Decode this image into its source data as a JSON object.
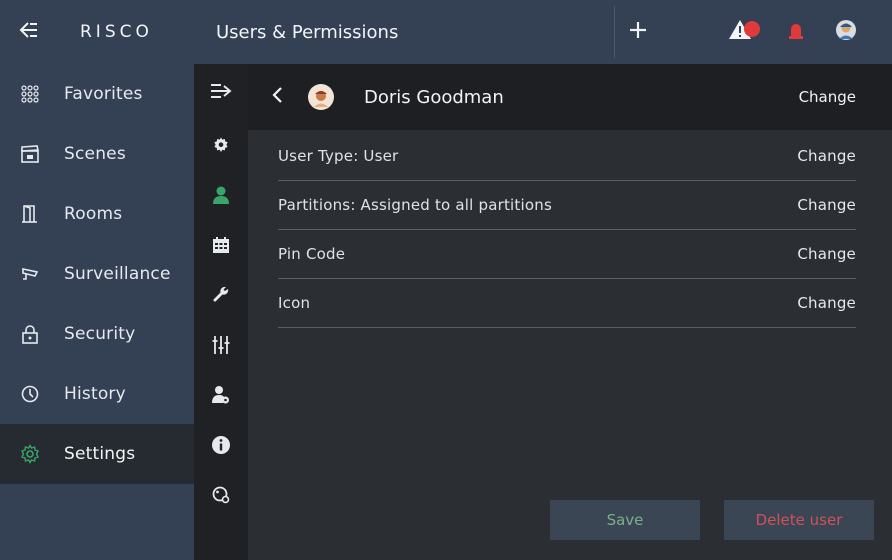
{
  "app": {
    "logo": "RISCO"
  },
  "header": {
    "title": "Users & Permissions"
  },
  "sidebar": {
    "items": [
      {
        "label": "Favorites",
        "icon": "grid-dots-icon"
      },
      {
        "label": "Scenes",
        "icon": "clapperboard-icon"
      },
      {
        "label": "Rooms",
        "icon": "door-icon"
      },
      {
        "label": "Surveillance",
        "icon": "camera-icon"
      },
      {
        "label": "Security",
        "icon": "lock-icon"
      },
      {
        "label": "History",
        "icon": "clock-icon"
      },
      {
        "label": "Settings",
        "icon": "gear-icon",
        "active": true
      }
    ]
  },
  "subrail": {
    "items": [
      "gear-icon",
      "user-icon",
      "calendar-icon",
      "wrench-icon",
      "sliders-icon",
      "user-settings-icon",
      "info-icon",
      "network-icon"
    ],
    "active": "user-icon"
  },
  "user": {
    "name": "Doris Goodman",
    "change_label": "Change"
  },
  "fields": [
    {
      "label": "User Type: User",
      "action": "Change"
    },
    {
      "label": "Partitions: Assigned to all partitions",
      "action": "Change"
    },
    {
      "label": "Pin Code",
      "action": "Change"
    },
    {
      "label": "Icon",
      "action": "Change"
    }
  ],
  "actions": {
    "save": "Save",
    "delete": "Delete user"
  },
  "colors": {
    "accent": "#3aa56b",
    "alert": "#e03a3a",
    "sidebar": "#344154",
    "save_text": "#7ab08a",
    "delete_text": "#d2505a"
  }
}
